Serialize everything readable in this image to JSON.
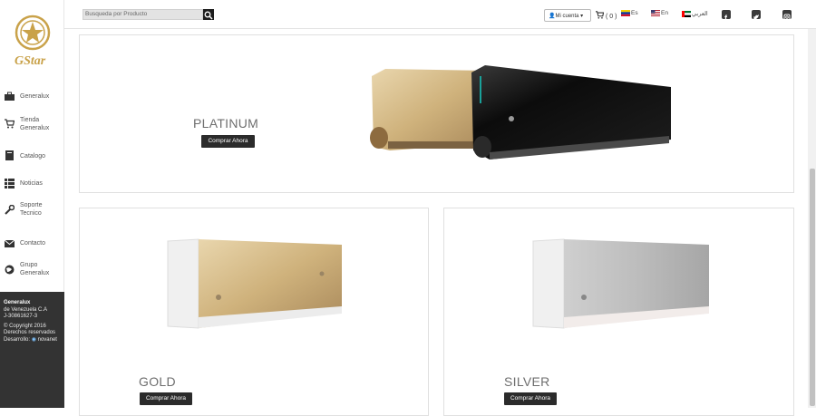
{
  "brand": {
    "name": "GStar"
  },
  "search": {
    "placeholder": "Busqueda por Producto"
  },
  "header": {
    "account_label": "Mi cuenta",
    "cart_label": "( 0 )",
    "languages": [
      {
        "code": "Es"
      },
      {
        "code": "En"
      },
      {
        "code": "العربي"
      }
    ],
    "social": [
      "facebook-icon",
      "twitter-icon",
      "instagram-icon"
    ]
  },
  "sidebar": {
    "items": [
      {
        "label": "Generalux",
        "icon": "briefcase-icon"
      },
      {
        "label": "Tienda Generalux",
        "icon": "cart-icon"
      },
      {
        "label": "Catalogo",
        "icon": "book-icon"
      },
      {
        "label": "Noticias",
        "icon": "list-icon"
      },
      {
        "label": "Soporte Tecnico",
        "icon": "wrench-icon"
      },
      {
        "label": "Contacto",
        "icon": "envelope-icon"
      },
      {
        "label": "Grupo Generalux",
        "icon": "globe-icon"
      }
    ],
    "footer": {
      "company": "Generalux",
      "company_line2": "de Venezuela C.A",
      "rif": "J-30861627-3",
      "copyright": "Copyright 2016",
      "rights": "Derechos reservados",
      "dev_label": "Desarrollo:",
      "dev_name": "novanet"
    }
  },
  "products": [
    {
      "name": "PLATINUM",
      "button": "Comprar Ahora"
    },
    {
      "name": "GOLD",
      "button": "Comprar Ahora"
    },
    {
      "name": "SILVER",
      "button": "Comprar Ahora"
    }
  ],
  "colors": {
    "footer_bg": "#333333",
    "button_bg": "#2b2b2b",
    "gold": "#d8c08e",
    "silver": "#b9b9b9",
    "black_unit": "#141414"
  }
}
